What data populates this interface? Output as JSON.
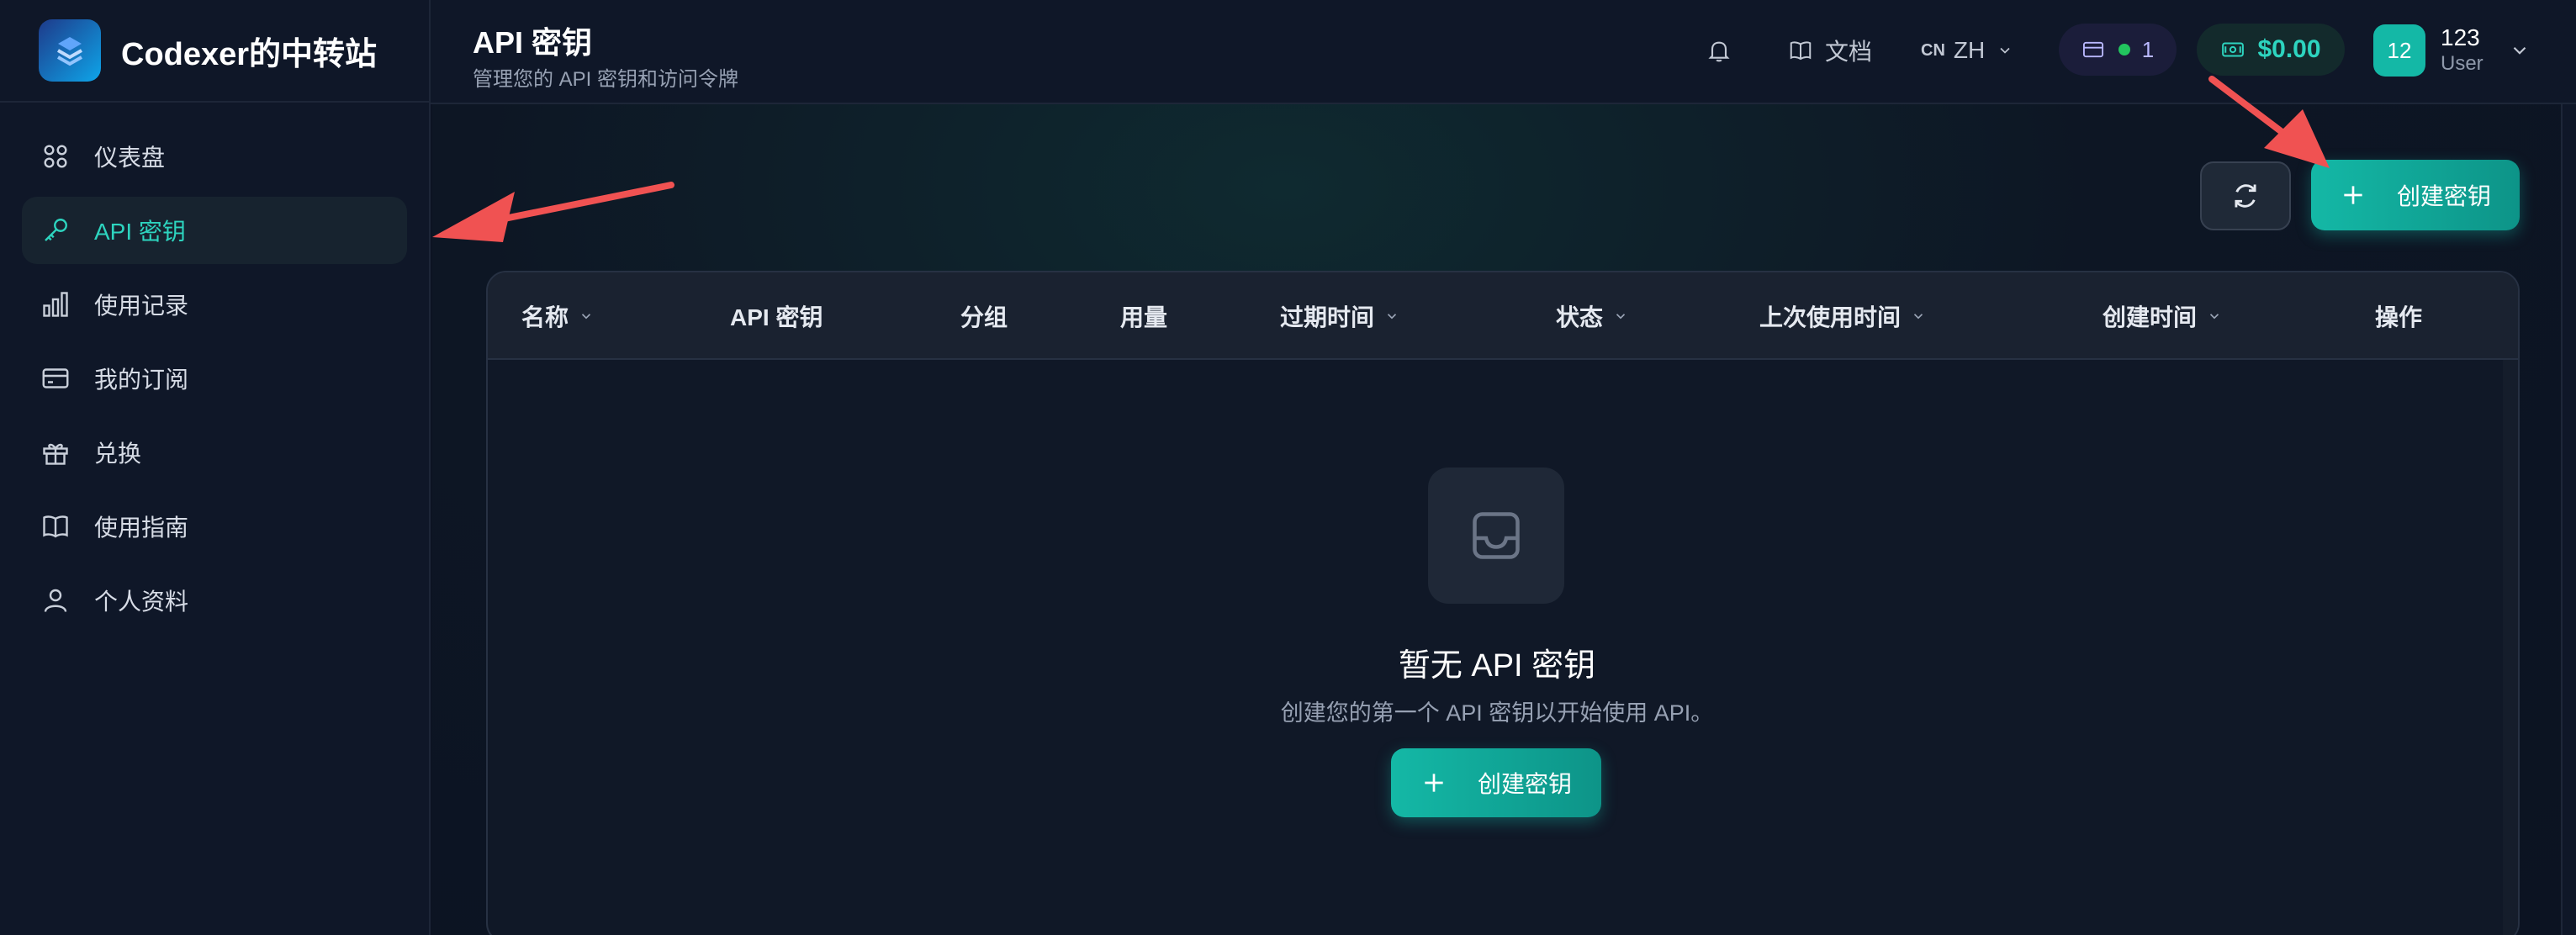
{
  "brand": {
    "name": "Codexer的中转站",
    "logo_icon": "brand-logo-icon"
  },
  "sidebar": {
    "items": [
      {
        "label": "仪表盘",
        "icon": "dashboard-icon"
      },
      {
        "label": "API 密钥",
        "icon": "key-icon",
        "active": true
      },
      {
        "label": "使用记录",
        "icon": "bar-chart-icon"
      },
      {
        "label": "我的订阅",
        "icon": "credit-card-icon"
      },
      {
        "label": "兑换",
        "icon": "gift-icon"
      },
      {
        "label": "使用指南",
        "icon": "book-icon"
      },
      {
        "label": "个人资料",
        "icon": "user-icon"
      }
    ]
  },
  "header": {
    "title": "API 密钥",
    "subtitle": "管理您的 API 密钥和访问令牌",
    "docs_label": "文档",
    "lang_flag": "CN",
    "lang_label": "ZH",
    "subscription_count": "1",
    "balance": "$0.00",
    "user": {
      "avatar_text": "12",
      "name": "123",
      "role": "User"
    }
  },
  "toolbar": {
    "create_label": "创建密钥"
  },
  "table": {
    "columns": [
      {
        "label": "名称",
        "sortable": true
      },
      {
        "label": "API 密钥",
        "sortable": false
      },
      {
        "label": "分组",
        "sortable": false
      },
      {
        "label": "用量",
        "sortable": false
      },
      {
        "label": "过期时间",
        "sortable": true
      },
      {
        "label": "状态",
        "sortable": true
      },
      {
        "label": "上次使用时间",
        "sortable": true
      },
      {
        "label": "创建时间",
        "sortable": true
      },
      {
        "label": "操作",
        "sortable": false
      }
    ]
  },
  "empty_state": {
    "title": "暂无 API 密钥",
    "description": "创建您的第一个 API 密钥以开始使用 API。",
    "create_label": "创建密钥"
  },
  "colors": {
    "accent": "#14b8a6",
    "annotation_arrow": "#f05252"
  }
}
